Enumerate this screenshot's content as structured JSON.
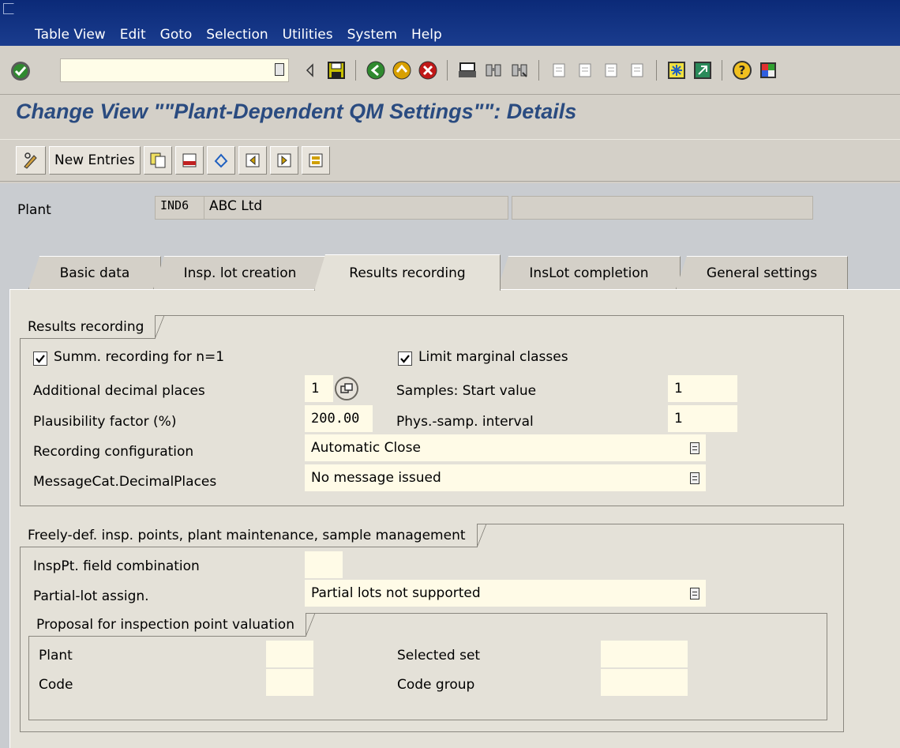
{
  "menu": {
    "items": [
      {
        "label": "Table View"
      },
      {
        "label": "Edit"
      },
      {
        "label": "Goto"
      },
      {
        "label": "Selection"
      },
      {
        "label": "Utilities"
      },
      {
        "label": "System"
      },
      {
        "label": "Help"
      }
    ]
  },
  "standard_toolbar": {
    "command_field_value": ""
  },
  "title": "Change View \"\"Plant-Dependent QM Settings\"\": Details",
  "app_toolbar": {
    "new_entries_label": "New Entries"
  },
  "header": {
    "plant_label": "Plant",
    "plant_code": "IND6",
    "plant_name": "ABC Ltd",
    "plant_extra": ""
  },
  "tabs": [
    {
      "label": "Basic data",
      "active": false
    },
    {
      "label": "Insp. lot creation",
      "active": false
    },
    {
      "label": "Results recording",
      "active": true
    },
    {
      "label": "InsLot completion",
      "active": false
    },
    {
      "label": "General settings",
      "active": false
    }
  ],
  "results_recording": {
    "group_title": "Results recording",
    "summ_recording_label": "Summ. recording for n=1",
    "summ_recording_checked": true,
    "limit_marginal_label": "Limit marginal classes",
    "limit_marginal_checked": true,
    "add_decimal_label": "Additional decimal places",
    "add_decimal_value": "1",
    "samples_start_label": "Samples: Start value",
    "samples_start_value": "1",
    "plausibility_label": "Plausibility factor (%)",
    "plausibility_value": "200.00",
    "phys_samp_label": "Phys.-samp. interval",
    "phys_samp_value": "1",
    "recording_config_label": "Recording configuration",
    "recording_config_value": "Automatic Close",
    "msgcat_label": "MessageCat.DecimalPlaces",
    "msgcat_value": "No message issued"
  },
  "insp_points": {
    "group_title": "Freely-def. insp. points, plant maintenance, sample management",
    "field_combination_label": "InspPt. field combination",
    "field_combination_value": "",
    "partial_lot_label": "Partial-lot assign.",
    "partial_lot_value": "Partial lots not supported",
    "proposal": {
      "group_title": "Proposal for inspection point valuation",
      "plant_label": "Plant",
      "plant_value": "",
      "selected_set_label": "Selected set",
      "selected_set_value": "",
      "code_label": "Code",
      "code_value": "",
      "code_group_label": "Code group",
      "code_group_value": ""
    }
  },
  "icons": {
    "enter": "green-check-icon",
    "back": "back-arrow-icon",
    "exit": "exit-icon",
    "cancel": "cancel-icon",
    "save": "save-icon",
    "print": "print-icon",
    "find": "find-icon",
    "help": "help-icon"
  },
  "colors": {
    "menubar": "#0b2a78",
    "title": "#2a4b80",
    "input_bg": "#fffbe7",
    "panel_bg": "#e4e1d8"
  }
}
